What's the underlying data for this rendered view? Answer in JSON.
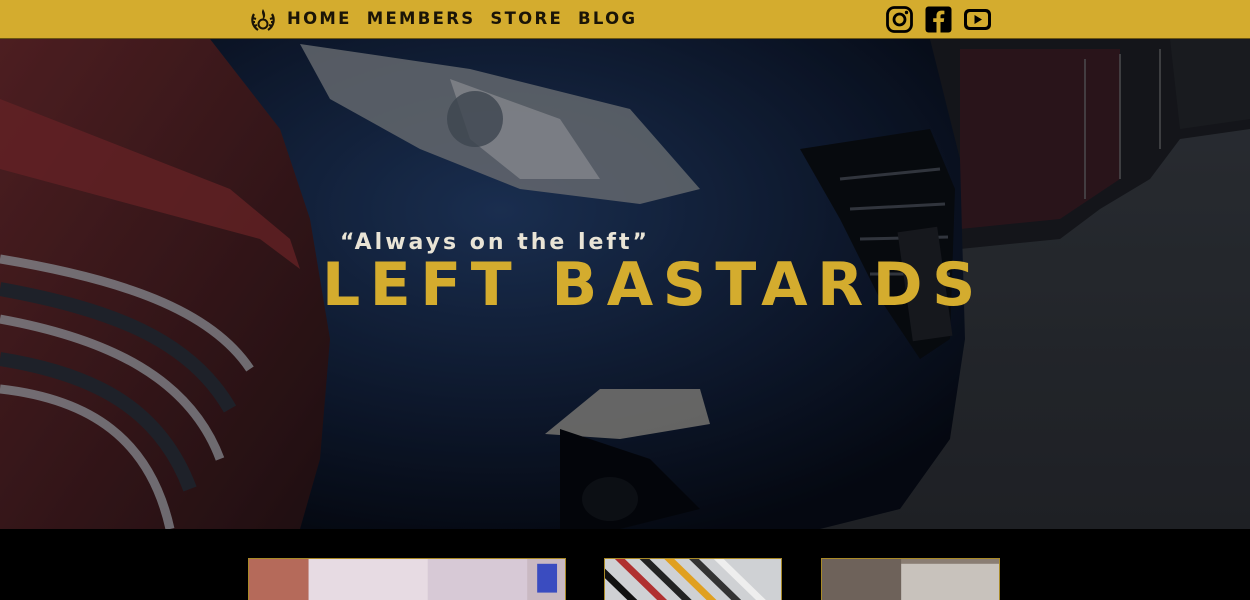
{
  "nav": {
    "logo_icon": "flame-laurel-logo",
    "links": [
      {
        "label": "HOME"
      },
      {
        "label": "MEMBERS"
      },
      {
        "label": "STORE"
      },
      {
        "label": "BLOG"
      }
    ],
    "socials": [
      {
        "icon": "instagram-icon"
      },
      {
        "icon": "facebook-icon"
      },
      {
        "icon": "youtube-icon"
      }
    ]
  },
  "hero": {
    "tagline": "“Always on the left”",
    "headline": "LEFT BASTARDS"
  },
  "cards": [
    {
      "name": "card-1"
    },
    {
      "name": "card-2"
    },
    {
      "name": "card-3"
    }
  ],
  "colors": {
    "accent": "#d4ac2e",
    "nav_text": "#1a1407",
    "tagline_text": "#e9e4d6",
    "background": "#000000"
  }
}
